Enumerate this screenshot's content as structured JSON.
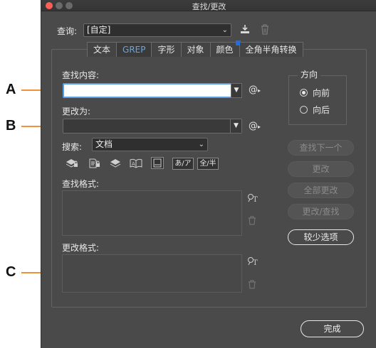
{
  "window": {
    "title": "查找/更改"
  },
  "query": {
    "label": "查询:",
    "value": "[自定]"
  },
  "tabs": [
    {
      "label": "文本",
      "active": false
    },
    {
      "label": "GREP",
      "active": true
    },
    {
      "label": "字形",
      "active": false
    },
    {
      "label": "对象",
      "active": false
    },
    {
      "label": "颜色",
      "active": false
    },
    {
      "label": "全角半角转换",
      "active": false
    }
  ],
  "find": {
    "label": "查找内容:",
    "value": ""
  },
  "change": {
    "label": "更改为:",
    "value": ""
  },
  "search": {
    "label": "搜索:",
    "value": "文档"
  },
  "mini_toggles": {
    "kana": "あ/ア",
    "width": "全/半"
  },
  "find_format": {
    "label": "查找格式:"
  },
  "change_format": {
    "label": "更改格式:"
  },
  "direction": {
    "label": "方向",
    "options": [
      {
        "label": "向前",
        "selected": true
      },
      {
        "label": "向后",
        "selected": false
      }
    ]
  },
  "buttons": {
    "find_next": "查找下一个",
    "change": "更改",
    "change_all": "全部更改",
    "change_find": "更改/查找",
    "fewer_options": "较少选项",
    "done": "完成"
  },
  "callouts": [
    "A",
    "B",
    "C"
  ],
  "colors": {
    "accent": "#5aa7f0",
    "focus": "#5a9fe6",
    "callout_line": "#f0923a"
  }
}
